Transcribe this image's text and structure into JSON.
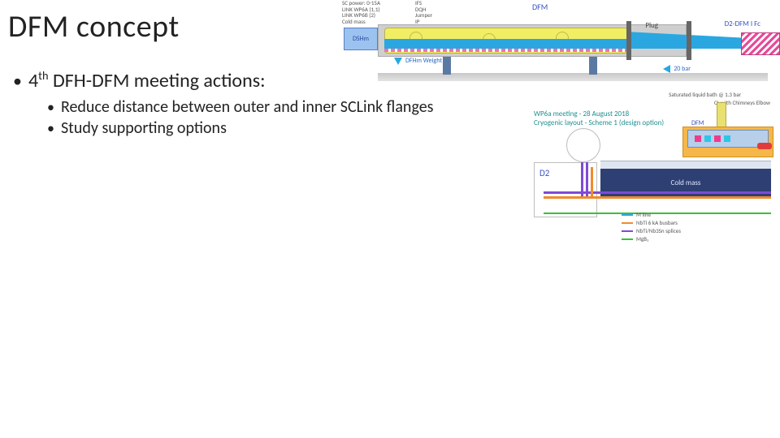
{
  "title": "DFM concept",
  "bullets": {
    "l1": {
      "ord_num": "4",
      "ord_suffix": "th",
      "rest": " DFH-DFM meeting actions:"
    },
    "l2": [
      "Reduce distance between outer and inner SCLink flanges",
      "Study supporting options"
    ]
  },
  "fig1": {
    "dfm_label": "DFM",
    "dsh_box": "DSHm",
    "plug": "Plug",
    "d2_dfm_ifc": "D2-DFM I Fc",
    "weight_label": "DFHm Weight",
    "bar_label": "20 bar",
    "legend_lines": [
      "SC power:  0-15A",
      "LINK WP6A (1,1)",
      "LINK WP6B (2)",
      "Cold mass"
    ],
    "legend_right": [
      "IFS",
      "DQH",
      "Jumper",
      "IP"
    ]
  },
  "fig2": {
    "caption_line1": "WP6a meeting - 28 August 2018",
    "caption_line2": "Cryogenic layout - Scheme 1 (design option)",
    "note_top": "Saturated liquid bath @ 1.3 bar",
    "cl_elbow": "CL with Chimneys Elbow",
    "dfm_label": "DFM",
    "d2_label": "D2",
    "sc_mass": "Cold mass",
    "legend": [
      {
        "color": "#2aa7e0",
        "label": "M line"
      },
      {
        "color": "#f08a2c",
        "label": "NbTi 6 kA busbars"
      },
      {
        "color": "#7e4bd5",
        "label": "NbTi/Nb3Sn splices"
      },
      {
        "color": "#3bbf3b",
        "label": "MgB₂"
      }
    ]
  }
}
